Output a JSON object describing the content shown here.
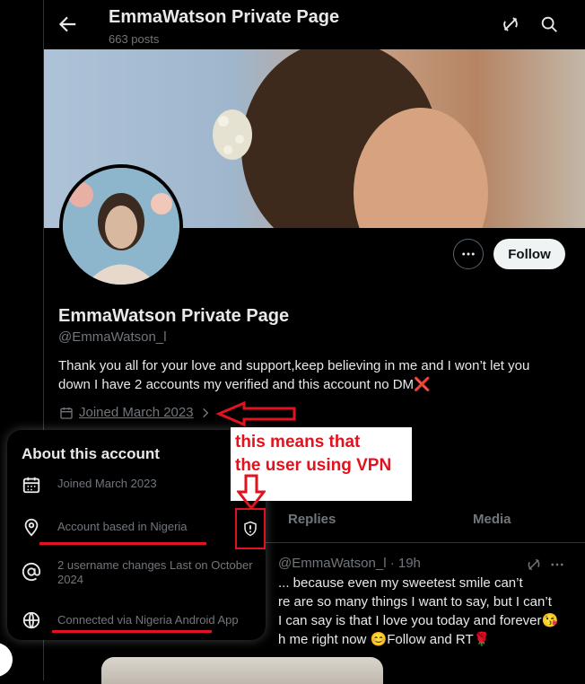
{
  "header": {
    "title": "EmmaWatson Private Page",
    "posts_count": "663 posts"
  },
  "profile": {
    "name": "EmmaWatson Private Page",
    "handle": "@EmmaWatson_l",
    "bio": "Thank you all for your love and support,keep believing in me and I won’t let you down  I have 2 accounts my verified and this account no DM❌",
    "joined": "Joined March 2023",
    "follow_label": "Follow"
  },
  "tabs": [
    "Replies",
    "Media"
  ],
  "tweet": {
    "header": "@EmmaWatson_l · 19h",
    "lines": [
      "... because even my sweetest smile can’t",
      "re are so many things I want to say, but I can’t",
      "I can say is that I love you today and forever😘",
      "h me right now 😊Follow and RT🌹"
    ]
  },
  "about": {
    "title": "About this account",
    "rows": [
      {
        "icon": "calendar-icon",
        "text": "Joined March 2023"
      },
      {
        "icon": "location-pin-icon",
        "text": "Account based in Nigeria"
      },
      {
        "icon": "at-sign-icon",
        "text": "2 username changes Last on October 2024"
      },
      {
        "icon": "globe-icon",
        "text": "Connected via Nigeria Android App"
      }
    ]
  },
  "annotation": {
    "note_line1": "this means that",
    "note_line2": "the user using VPN",
    "color": "#e0131e"
  }
}
